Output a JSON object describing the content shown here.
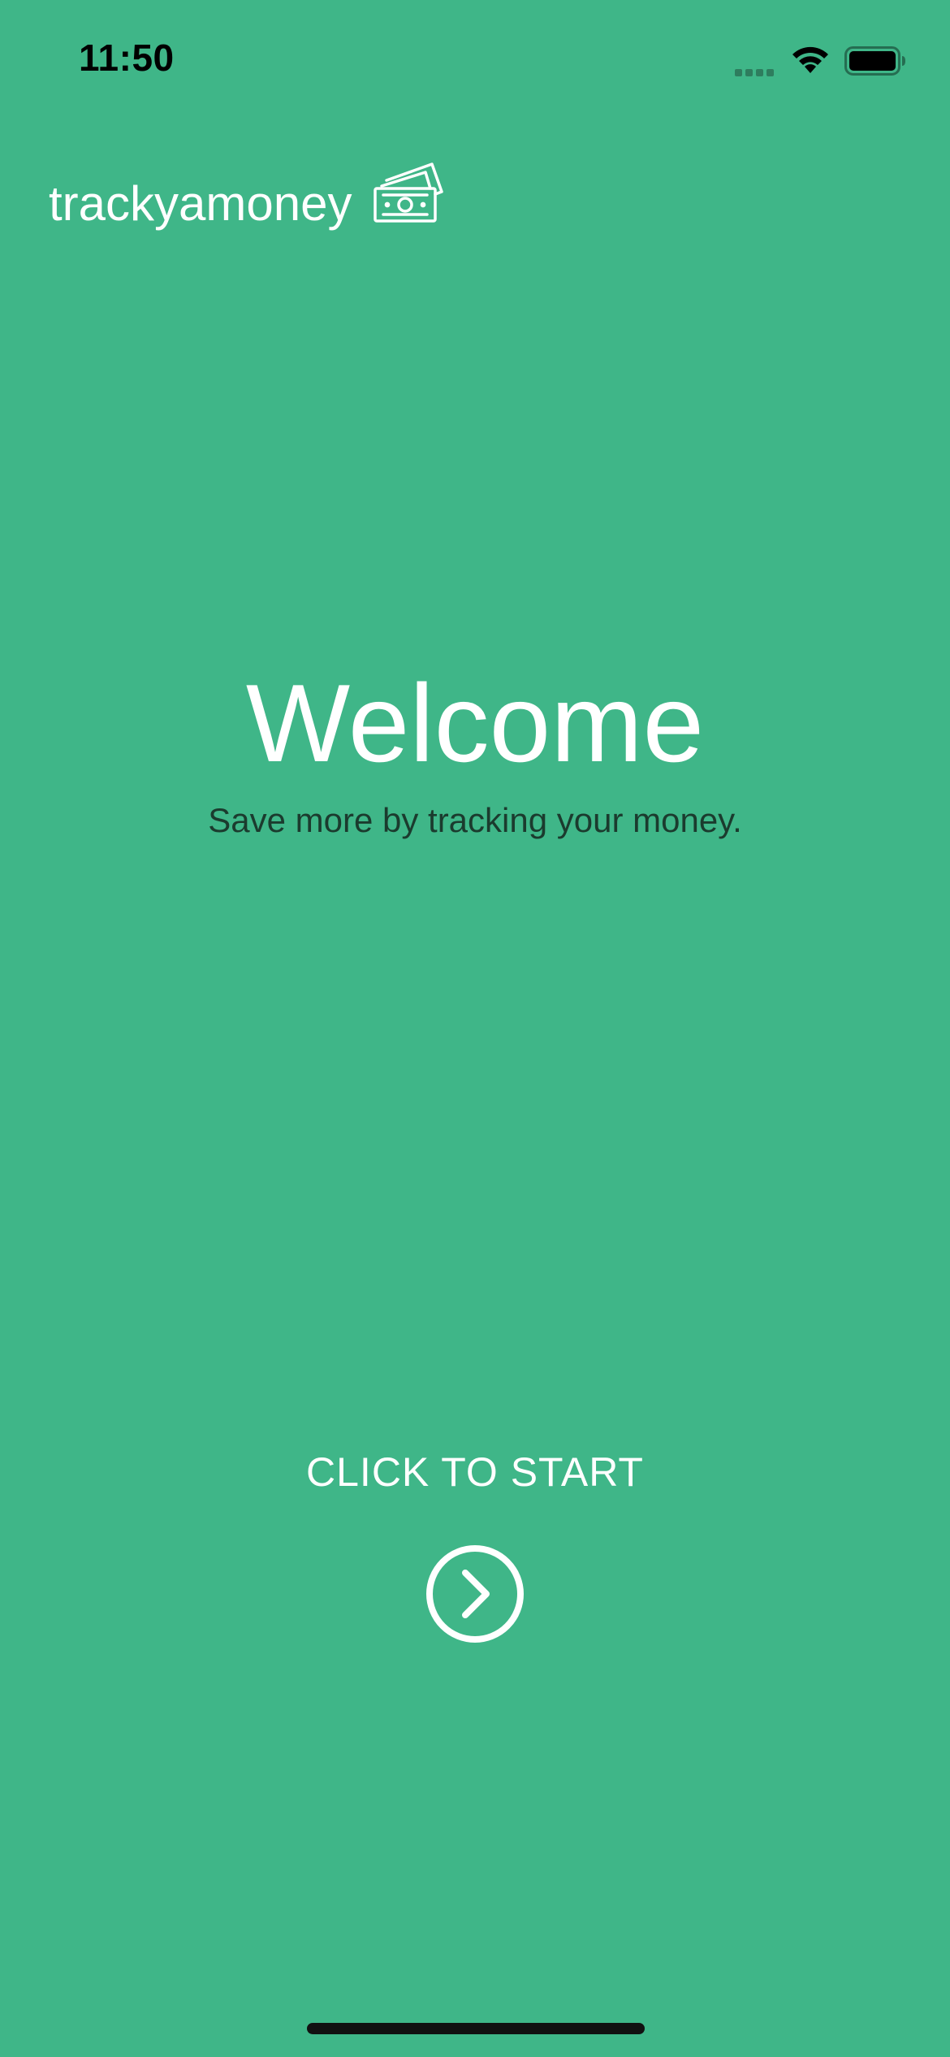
{
  "status_bar": {
    "time": "11:50",
    "signal_icon": "cellular-signal-icon",
    "wifi_icon": "wifi-icon",
    "battery_icon": "battery-icon"
  },
  "brand": {
    "name": "trackyamoney",
    "icon": "money-bills-icon"
  },
  "welcome": {
    "title": "Welcome",
    "subtitle": "Save more by tracking your money."
  },
  "start": {
    "label": "CLICK TO START",
    "button_icon": "chevron-right-circle-icon"
  },
  "colors": {
    "background": "#3FB688",
    "text_primary": "#FFFFFF",
    "text_secondary": "#1B3B2E"
  }
}
